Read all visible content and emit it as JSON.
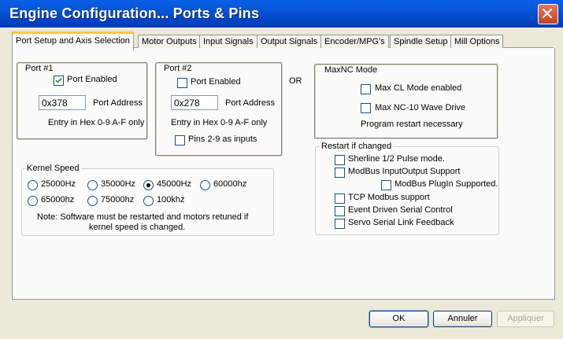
{
  "window": {
    "title": "Engine Configuration... Ports & Pins"
  },
  "tabs": [
    {
      "label": "Port Setup and Axis Selection"
    },
    {
      "label": "Motor Outputs"
    },
    {
      "label": "Input Signals"
    },
    {
      "label": "Output Signals"
    },
    {
      "label": "Encoder/MPG's"
    },
    {
      "label": "Spindle Setup"
    },
    {
      "label": "Mill Options"
    }
  ],
  "port1": {
    "legend": "Port #1",
    "enabled_label": "Port Enabled",
    "enabled": true,
    "address_value": "0x378",
    "address_label": "Port Address",
    "hint": "Entry in Hex 0-9 A-F only"
  },
  "port2": {
    "legend": "Port #2",
    "enabled_label": "Port Enabled",
    "enabled": false,
    "address_value": "0x278",
    "address_label": "Port Address",
    "hint": "Entry in Hex 0-9 A-F only",
    "pins_label": "Pins 2-9 as inputs"
  },
  "or_label": "OR",
  "maxnc": {
    "legend": "MaxNC Mode",
    "cl_label": "Max CL Mode enabled",
    "wave_label": "Max NC-10 Wave Drive",
    "note": "Program restart necessary"
  },
  "kernel": {
    "legend": "Kernel Speed",
    "options": [
      {
        "label": "25000Hz",
        "selected": false
      },
      {
        "label": "35000Hz",
        "selected": false
      },
      {
        "label": "45000Hz",
        "selected": true
      },
      {
        "label": "60000hz",
        "selected": false
      },
      {
        "label": "65000hz",
        "selected": false
      },
      {
        "label": "75000hz",
        "selected": false
      },
      {
        "label": "100khz",
        "selected": false
      }
    ],
    "note_line1": "Note: Software must be restarted and motors retuned if",
    "note_line2": "kernel speed is changed."
  },
  "restart": {
    "legend": "Restart if changed",
    "items": [
      {
        "label": "Sherline 1/2 Pulse mode."
      },
      {
        "label": "ModBus InputOutput Support"
      },
      {
        "label": "ModBus PlugIn Supported."
      },
      {
        "label": "TCP Modbus support"
      },
      {
        "label": "Event Driven Serial Control"
      },
      {
        "label": "Servo Serial Link Feedback"
      }
    ]
  },
  "buttons": {
    "ok": "OK",
    "cancel": "Annuler",
    "apply": "Appliquer"
  },
  "colors": {
    "titlebar": "#0054e3",
    "close": "#d9542b",
    "active_tab_accent": "#ffc83c"
  }
}
